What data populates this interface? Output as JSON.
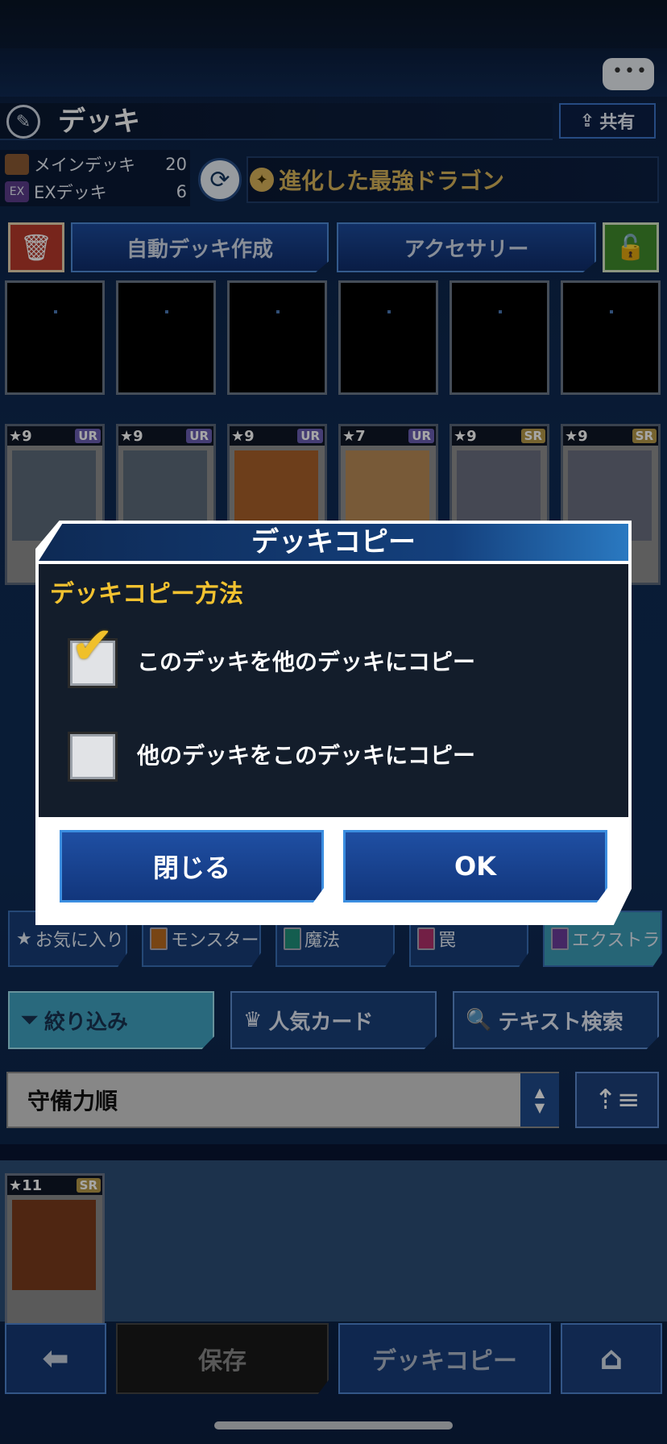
{
  "header": {
    "title": "デッキ",
    "share_label": "共有"
  },
  "deck": {
    "main_label": "メインデッキ",
    "main_count": "20",
    "ex_icon_text": "EX",
    "ex_label": "EXデッキ",
    "ex_count": "6",
    "name": "進化した最強ドラゴン"
  },
  "actions": {
    "auto_build": "自動デッキ作成",
    "accessory": "アクセサリー"
  },
  "cards": [
    {
      "level": "9",
      "rarity": "UR"
    },
    {
      "level": "9",
      "rarity": "UR"
    },
    {
      "level": "9",
      "rarity": "UR"
    },
    {
      "level": "7",
      "rarity": "UR"
    },
    {
      "level": "9",
      "rarity": "SR"
    },
    {
      "level": "9",
      "rarity": "SR"
    }
  ],
  "filter_tabs": [
    "お気に入り",
    "モンスター",
    "魔法",
    "罠",
    "エクストラ"
  ],
  "tools": {
    "filter": "絞り込み",
    "popular": "人気カード",
    "text_search": "テキスト検索"
  },
  "sort": {
    "value": "守備力順"
  },
  "collection_card": {
    "level": "11",
    "rarity": "SR"
  },
  "bottom_nav": {
    "save": "保存",
    "deck_copy": "デッキコピー"
  },
  "dialog": {
    "title": "デッキコピー",
    "section": "デッキコピー方法",
    "option1": "このデッキを他のデッキにコピー",
    "option1_checked": true,
    "option2": "他のデッキをこのデッキにコピー",
    "option2_checked": false,
    "close": "閉じる",
    "ok": "OK"
  },
  "colors": {
    "accent_gold": "#f2c230",
    "button_blue": "#1f4fa3",
    "ur_badge": "#6a5fb3",
    "sr_badge": "#b59849"
  }
}
